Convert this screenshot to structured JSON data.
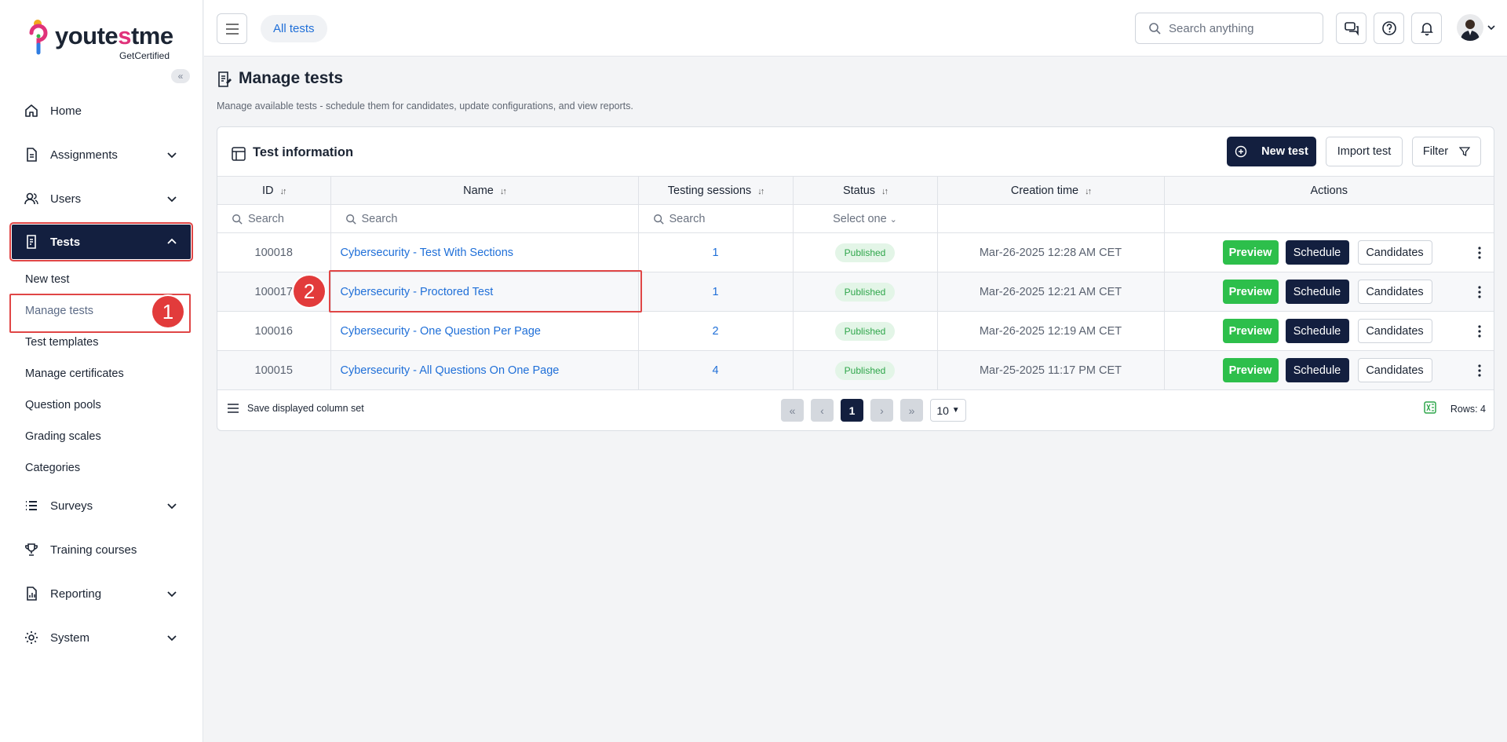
{
  "brand": {
    "name_part1": "youte",
    "name_accent": "s",
    "name_part2": "tme",
    "tagline": "GetCertified"
  },
  "sidebar": {
    "items": [
      {
        "label": "Home",
        "icon": "home-icon"
      },
      {
        "label": "Assignments",
        "icon": "assignments-icon"
      },
      {
        "label": "Users",
        "icon": "users-icon"
      },
      {
        "label": "Tests",
        "icon": "tests-icon"
      },
      {
        "label": "Surveys",
        "icon": "surveys-icon"
      },
      {
        "label": "Training courses",
        "icon": "trophy-icon"
      },
      {
        "label": "Reporting",
        "icon": "reporting-icon"
      },
      {
        "label": "System",
        "icon": "gear-icon"
      }
    ],
    "tests_subitems": [
      "New test",
      "Manage tests",
      "Test templates",
      "Manage certificates",
      "Question pools",
      "Grading scales",
      "Categories"
    ],
    "step_markers": [
      "1",
      "2"
    ]
  },
  "topbar": {
    "breadcrumb": "All tests",
    "search_placeholder": "Search anything"
  },
  "page": {
    "title": "Manage tests",
    "subtitle": "Manage available tests - schedule them for candidates, update configurations, and view reports."
  },
  "card": {
    "title": "Test information",
    "new_test": "New test",
    "import_test": "Import test",
    "filter": "Filter"
  },
  "table": {
    "columns": [
      "ID",
      "Name",
      "Testing sessions",
      "Status",
      "Creation time",
      "Actions"
    ],
    "filter_placeholder": "Search",
    "status_select": "Select one",
    "rows": [
      {
        "id": "100018",
        "name": "Cybersecurity - Test With Sections",
        "sessions": "1",
        "status": "Published",
        "created": "Mar-26-2025 12:28 AM CET"
      },
      {
        "id": "100017",
        "name": "Cybersecurity - Proctored Test",
        "sessions": "1",
        "status": "Published",
        "created": "Mar-26-2025 12:21 AM CET"
      },
      {
        "id": "100016",
        "name": "Cybersecurity - One Question Per Page",
        "sessions": "2",
        "status": "Published",
        "created": "Mar-26-2025 12:19 AM CET"
      },
      {
        "id": "100015",
        "name": "Cybersecurity - All Questions On One Page",
        "sessions": "4",
        "status": "Published",
        "created": "Mar-25-2025 11:17 PM CET"
      }
    ],
    "actions": {
      "preview": "Preview",
      "schedule": "Schedule",
      "candidates": "Candidates"
    }
  },
  "footer": {
    "save_set": "Save displayed column set",
    "current_page": "1",
    "page_size": "10",
    "rows": "Rows: 4"
  }
}
